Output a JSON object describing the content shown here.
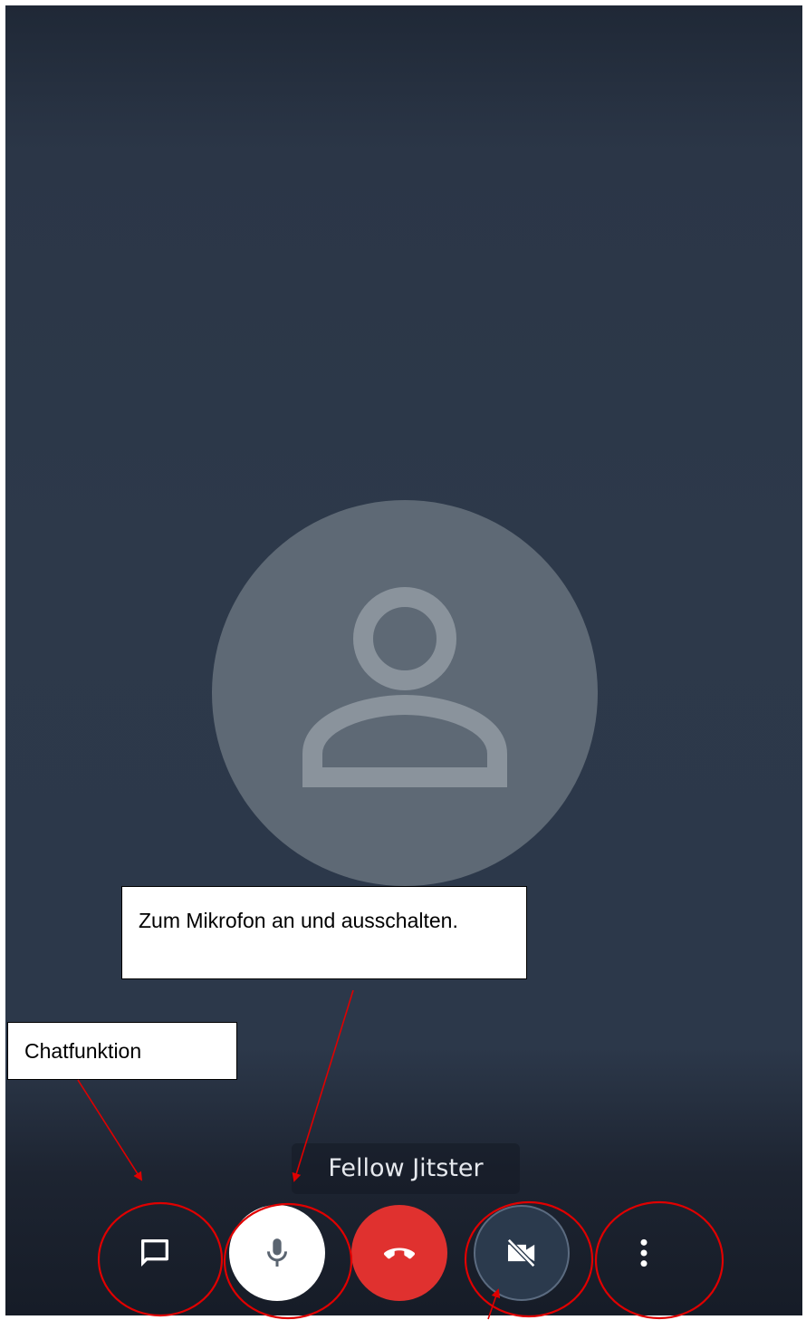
{
  "call": {
    "participant_name": "Fellow Jitster",
    "avatar_icon": "person-icon"
  },
  "toolbar": {
    "buttons": [
      {
        "name": "chat",
        "icon": "chat-bubble-icon"
      },
      {
        "name": "microphone",
        "icon": "microphone-icon"
      },
      {
        "name": "hangup",
        "icon": "phone-hangup-icon"
      },
      {
        "name": "camera",
        "icon": "video-off-icon"
      },
      {
        "name": "more",
        "icon": "more-vertical-icon"
      }
    ]
  },
  "annotations": {
    "mic_callout": "Zum Mikrofon an und ausschalten.",
    "chat_callout": "Chatfunktion",
    "marker_color": "#e00000"
  },
  "colors": {
    "background_top": "#1f2836",
    "background_mid": "#2d394a",
    "avatar_circle": "#5e6975",
    "avatar_glyph": "#8a939c",
    "hangup_red": "#e0312f",
    "camera_button": "#2b3a4d"
  }
}
